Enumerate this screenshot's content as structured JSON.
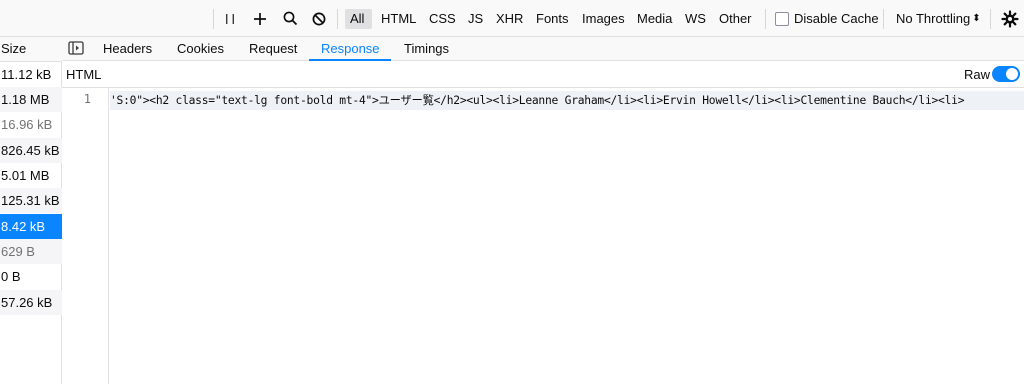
{
  "toolbar": {
    "pause_icon": "pause-icon",
    "add_icon": "plus-icon",
    "search_icon": "search-icon",
    "block_icon": "block-icon",
    "filters": [
      "All",
      "HTML",
      "CSS",
      "JS",
      "XHR",
      "Fonts",
      "Images",
      "Media",
      "WS",
      "Other"
    ],
    "active_filter": "All",
    "disable_cache_label": "Disable Cache",
    "disable_cache_checked": false,
    "throttling_label": "No Throttling",
    "throttling_arrow": "⬍",
    "settings_icon": "gear-icon"
  },
  "requests": {
    "size_header": "Size",
    "sizes": [
      "11.12 kB",
      "1.18 MB",
      "16.96 kB",
      "826.45 kB",
      "5.01 MB",
      "125.31 kB",
      "8.42 kB",
      "629 B",
      "0 B",
      "57.26 kB"
    ],
    "selected_index": 6,
    "dim_indices": [
      2,
      7
    ]
  },
  "details": {
    "tabs": [
      "Headers",
      "Cookies",
      "Request",
      "Response",
      "Timings"
    ],
    "active_tab": "Response",
    "toggle_sidebar_icon": "sidebar-toggle-icon",
    "format_label": "HTML",
    "raw_label": "Raw",
    "raw_enabled": true,
    "line_number": "1",
    "code_line": "'S:0\"><h2 class=\"text-lg font-bold mt-4\">ユーザー覧</h2><ul><li>Leanne Graham</li><li>Ervin Howell</li><li>Clementine Bauch</li><li>"
  },
  "colors": {
    "accent": "#0a84ff",
    "toolbar_bg": "#f9f9fa",
    "border": "#e0e0e2",
    "row_stripe": "#f5f5f7"
  }
}
